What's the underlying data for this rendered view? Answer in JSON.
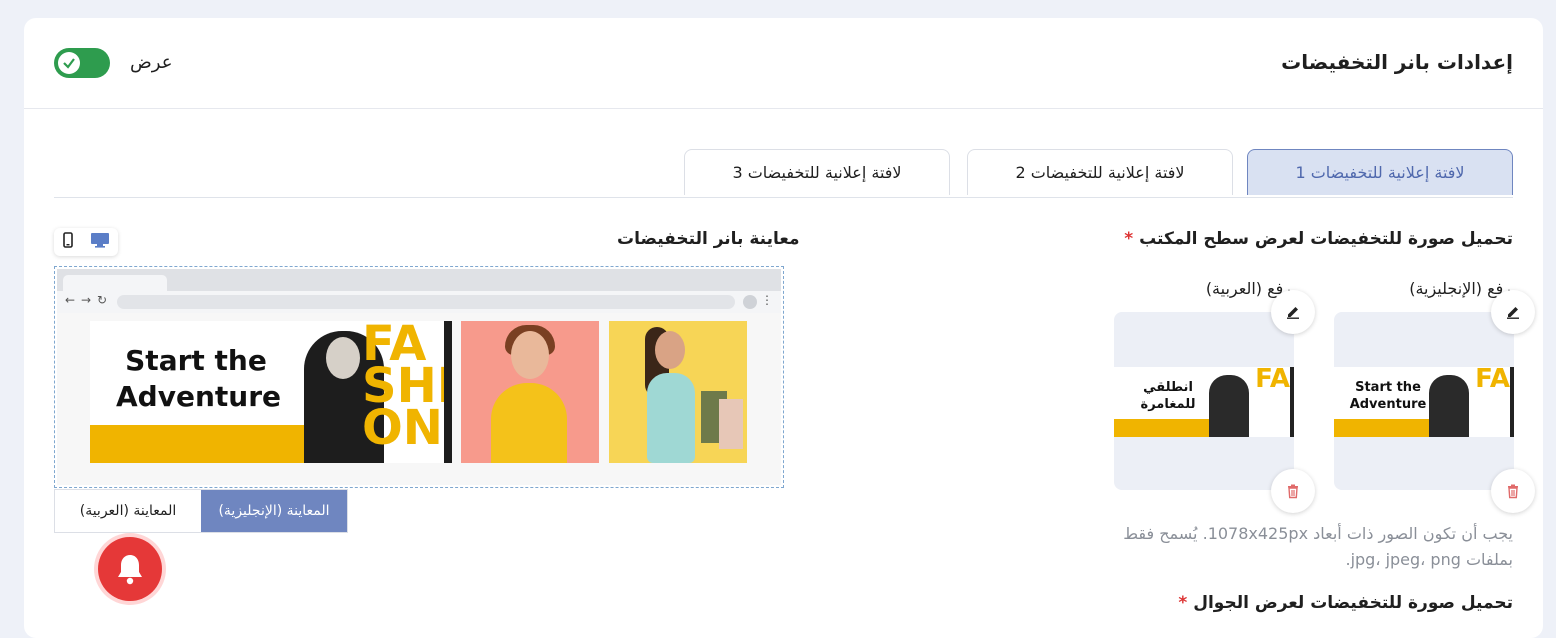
{
  "header": {
    "title": "إعدادات بانر التخفيضات",
    "toggle_label": "عرض",
    "toggle_state": "on"
  },
  "tabs": [
    {
      "label": "لافتة إعلانية للتخفيضات 1",
      "active": true
    },
    {
      "label": "لافتة إعلانية للتخفيضات 2",
      "active": false
    },
    {
      "label": "لافتة إعلانية للتخفيضات 3",
      "active": false
    }
  ],
  "desktop_upload": {
    "title": "تحميل صورة للتخفيضات لعرض سطح المكتب",
    "required_mark": "*",
    "english_label": "رفع (الإنجليزية)",
    "arabic_label": "رفع (العربية)",
    "english_preview_text": "Start the Adventure",
    "arabic_preview_text": "انطلقي للمغامرة",
    "help_text": "يجب أن تكون الصور ذات أبعاد 1078x425px. يُسمح فقط بملفات jpg، jpeg، png."
  },
  "mobile_upload": {
    "title": "تحميل صورة للتخفيضات لعرض الجوال",
    "required_mark": "*"
  },
  "preview": {
    "title": "معاينة بانر التخفيضات",
    "headline": "Start the Adventure",
    "brand_letters": "FA SHI ON",
    "english_button": "المعاينة (الإنجليزية)",
    "arabic_button": "المعاينة (العربية)",
    "active_language": "english"
  },
  "colors": {
    "accent": "#6f86c0",
    "toggle_on": "#2e9c4e",
    "banner_yellow": "#f0b400",
    "notification": "#e53838",
    "delete": "#e06a6a"
  }
}
